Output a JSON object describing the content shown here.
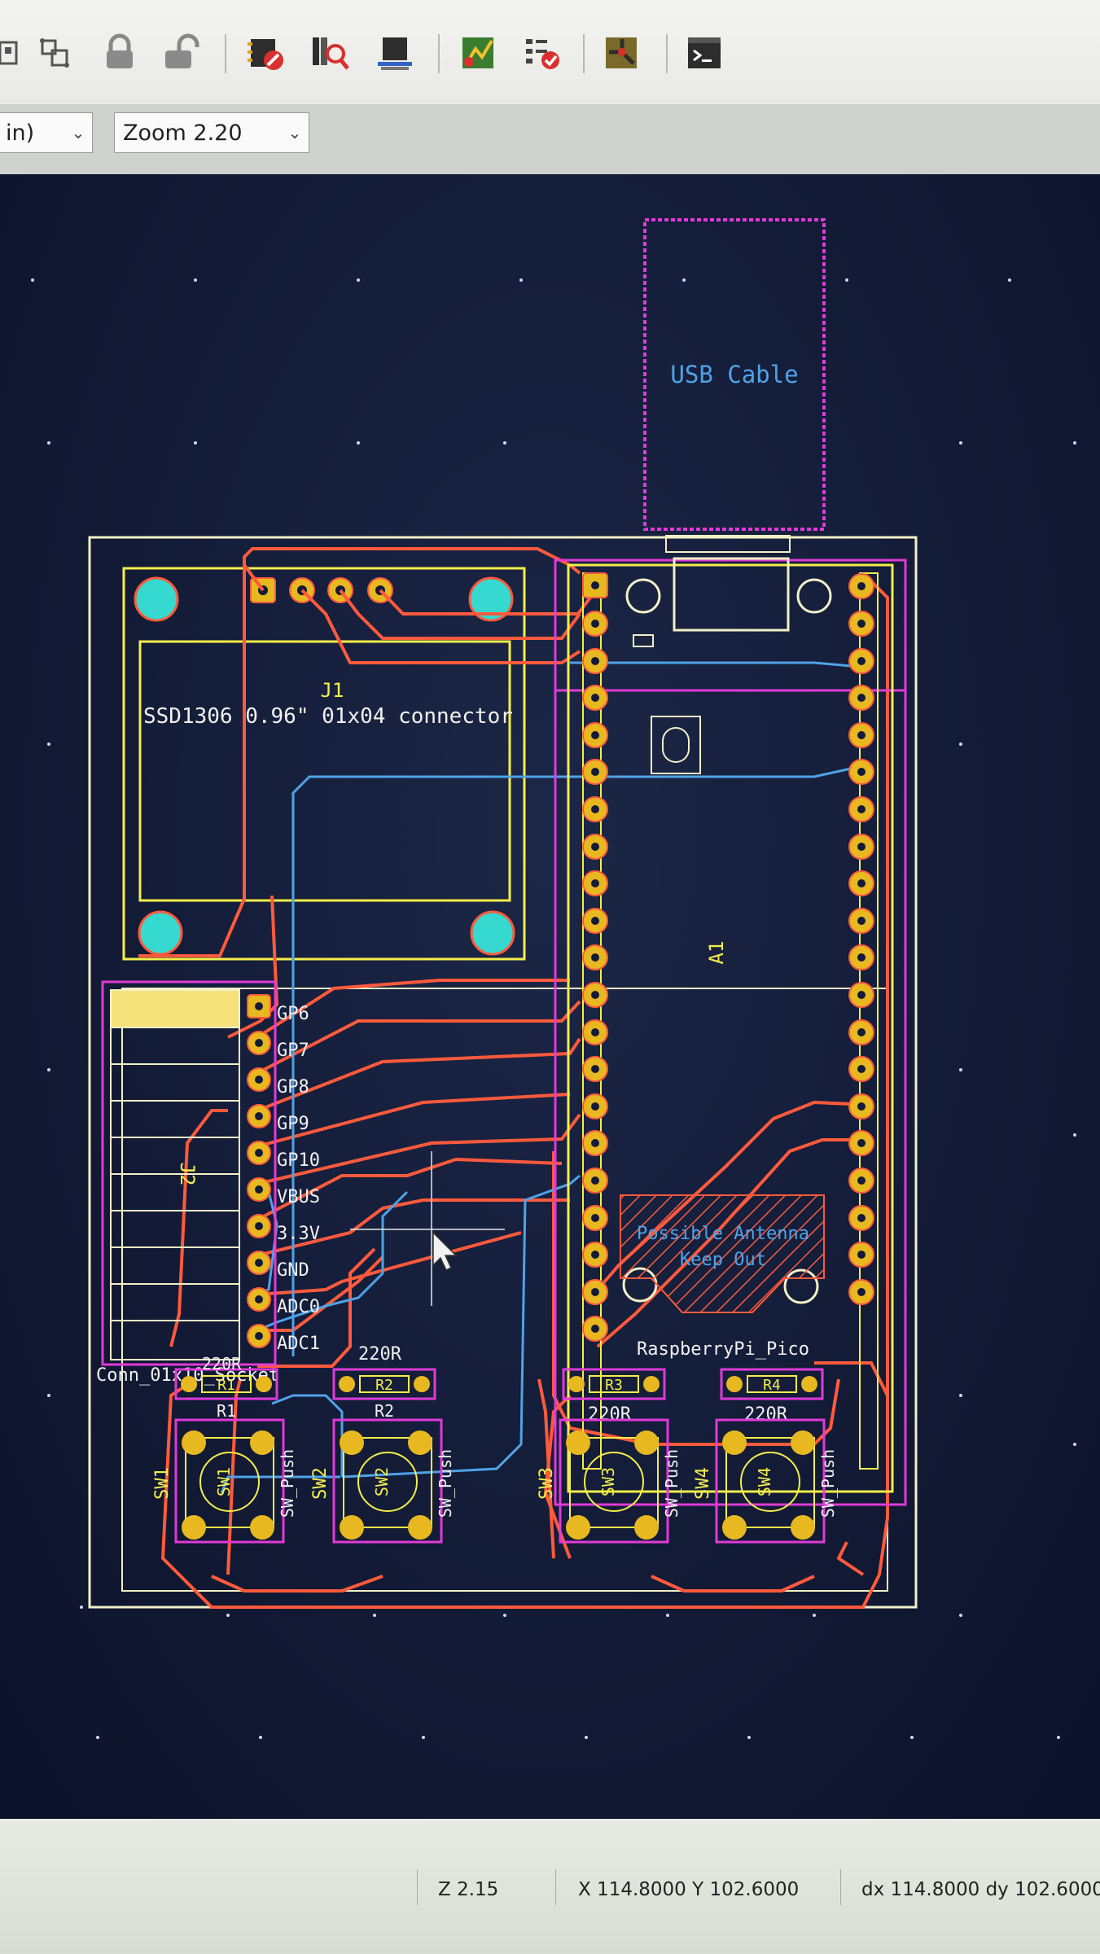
{
  "toolbar": {
    "icons": [
      "group-icon",
      "ungroup-icon",
      "lock-icon",
      "unlock-icon",
      "footprint-editor-icon",
      "footprint-library-browser-icon",
      "3d-viewer-icon",
      "schematic-update-icon",
      "drc-icon",
      "route-tracks-icon",
      "scripting-console-icon"
    ],
    "units_select": "in)",
    "zoom_select": "Zoom 2.20"
  },
  "colors": {
    "board_outline": "#f2f0c8",
    "courtyard": "#e03ad8",
    "silkscreen": "#f5ee4a",
    "front_copper": "#ff5a3c",
    "back_copper": "#4fa3e8",
    "pad_copper": "#e8b820",
    "mounting_hole": "#35d9d0",
    "canvas_bg": "#131b38"
  },
  "pcb": {
    "usb_label": "USB Cable",
    "oled_ref": "J1",
    "oled_value": "SSD1306 0.96\" 01x04 connector",
    "socket_ref": "J2",
    "socket_value": "Conn_01x10_Socket",
    "socket_pin_labels": [
      "GP6",
      "GP7",
      "GP8",
      "GP9",
      "GP10",
      "VBUS",
      "3.3V",
      "GND",
      "ADC0",
      "ADC1"
    ],
    "pico_ref": "A1",
    "pico_value": "RaspberryPi_Pico",
    "antenna_text_1": "Possible Antenna",
    "antenna_text_2": "Keep Out",
    "resistors": [
      {
        "ref": "R1",
        "value": "220R"
      },
      {
        "ref": "R2",
        "value": "220R"
      },
      {
        "ref": "R3",
        "value": "220R"
      },
      {
        "ref": "R4",
        "value": "220R"
      }
    ],
    "switches": [
      {
        "ref": "SW1",
        "value": "SW_Push"
      },
      {
        "ref": "SW2",
        "value": "SW_Push"
      },
      {
        "ref": "SW3",
        "value": "SW_Push"
      },
      {
        "ref": "SW4",
        "value": "SW_Push"
      }
    ]
  },
  "statusbar": {
    "zoom": "Z 2.15",
    "cursor": "X 114.8000  Y 102.6000",
    "delta": "dx 114.8000  dy 102.6000"
  }
}
